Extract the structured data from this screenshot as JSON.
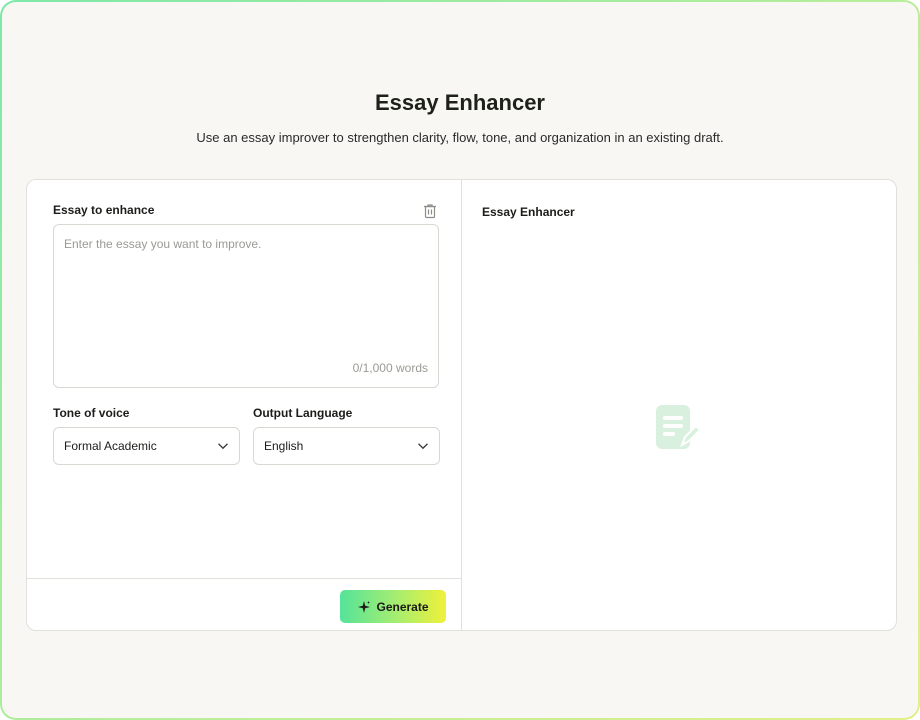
{
  "header": {
    "title": "Essay Enhancer",
    "subtitle": "Use an essay improver to strengthen clarity, flow, tone, and organization in an existing draft."
  },
  "form": {
    "essay_label": "Essay to enhance",
    "essay_placeholder": "Enter the essay you want to improve.",
    "essay_value": "",
    "word_count": "0/1,000 words",
    "tone": {
      "label": "Tone of voice",
      "selected": "Formal Academic"
    },
    "language": {
      "label": "Output Language",
      "selected": "English"
    },
    "generate_label": "Generate"
  },
  "output": {
    "title": "Essay Enhancer",
    "empty_icon": "document-edit-icon"
  },
  "icons": {
    "clear": "trash-icon",
    "chevron": "chevron-down-icon",
    "generate": "sparkle-icon"
  },
  "colors": {
    "accent_start": "#55e39a",
    "accent_end": "#f0f03a",
    "placeholder_icon": "#d8f0dd",
    "background": "#f8f7f4"
  }
}
